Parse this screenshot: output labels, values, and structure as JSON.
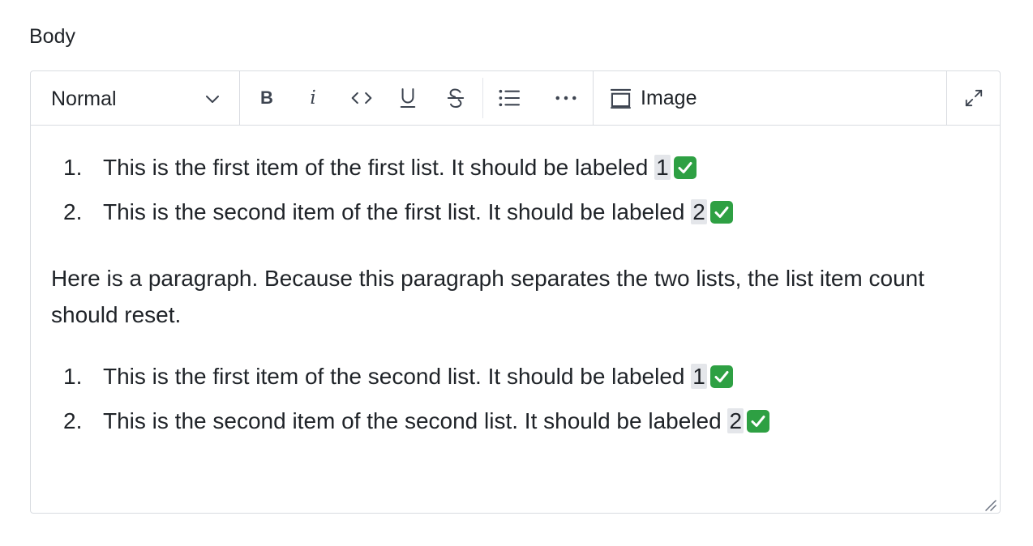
{
  "field": {
    "label": "Body"
  },
  "toolbar": {
    "style_select": {
      "value": "Normal"
    },
    "bold_label": "B",
    "italic_label": "i",
    "image_label": "Image"
  },
  "content": {
    "list1": [
      {
        "number": "1.",
        "text": "This is the first item of the first list. It should be labeled ",
        "code": "1"
      },
      {
        "number": "2.",
        "text": "This is the second item of the first list. It should be labeled ",
        "code": "2"
      }
    ],
    "paragraph": "Here is a paragraph. Because this paragraph separates the two lists, the list item count should reset.",
    "list2": [
      {
        "number": "1.",
        "text": "This is the first item of the second list. It should be labeled ",
        "code": "1"
      },
      {
        "number": "2.",
        "text": "This is the second item of the second list. It should be labeled ",
        "code": "2"
      }
    ]
  },
  "colors": {
    "check": "#2ea043",
    "border": "#d9dce1",
    "code_bg": "#e4e6ea"
  },
  "icons": {
    "style_dropdown": "chevron-down-icon",
    "code": "code-icon",
    "underline": "underline-icon",
    "strike": "strikethrough-icon",
    "list": "bulleted-list-icon",
    "more": "more-icon",
    "image": "image-icon",
    "expand": "expand-icon",
    "check": "check-mark-icon",
    "resize": "resize-handle-icon"
  }
}
